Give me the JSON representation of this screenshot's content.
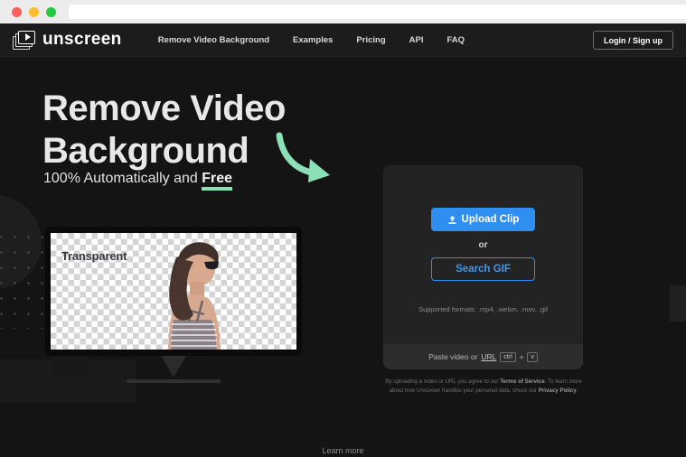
{
  "browser": {
    "dots": [
      "close-red",
      "minimize-yellow",
      "maximize-green"
    ],
    "url_value": "",
    "url_placeholder": ""
  },
  "header": {
    "logo_text": "unscreen",
    "logo_icon": "video-frames-play-icon",
    "nav": [
      {
        "label": "Remove Video Background",
        "name": "nav-remove-video-background"
      },
      {
        "label": "Examples",
        "name": "nav-examples"
      },
      {
        "label": "Pricing",
        "name": "nav-pricing"
      },
      {
        "label": "API",
        "name": "nav-api"
      },
      {
        "label": "FAQ",
        "name": "nav-faq"
      }
    ],
    "login_label": "Login / Sign up"
  },
  "hero": {
    "title_line1": "Remove Video",
    "title_line2": "Background",
    "subtitle_prefix": "100% Automatically and ",
    "subtitle_highlight": "Free",
    "arrow_icon": "curved-arrow-down-right-icon",
    "arrow_color": "#8ce0b5",
    "underline_color": "#8ce0b5"
  },
  "preview": {
    "screen_label": "Transparent",
    "checkerboard": true,
    "device": "desktop-monitor"
  },
  "upload": {
    "upload_button_label": "Upload Clip",
    "upload_button_icon": "upload-arrow-icon",
    "or_label": "or",
    "search_gif_label": "Search GIF",
    "supported_formats": "Supported formats: .mp4, .webm, .mov, .gif",
    "paste_prefix": "Paste video or ",
    "paste_url_link": "URL",
    "key_ctrl": "ctrl",
    "key_plus": "+",
    "key_v": "v",
    "primary_color": "#2f8ff0"
  },
  "legal": {
    "line1_a": "By uploading a video or URL you agree to our ",
    "line1_b": "Terms of Service",
    "line1_c": ". To learn more",
    "line2_a": "about how Unscreen handles your personal data, check our ",
    "line2_b": "Privacy Policy",
    "line2_c": "."
  },
  "footer": {
    "learn_more_label": "Learn more"
  }
}
